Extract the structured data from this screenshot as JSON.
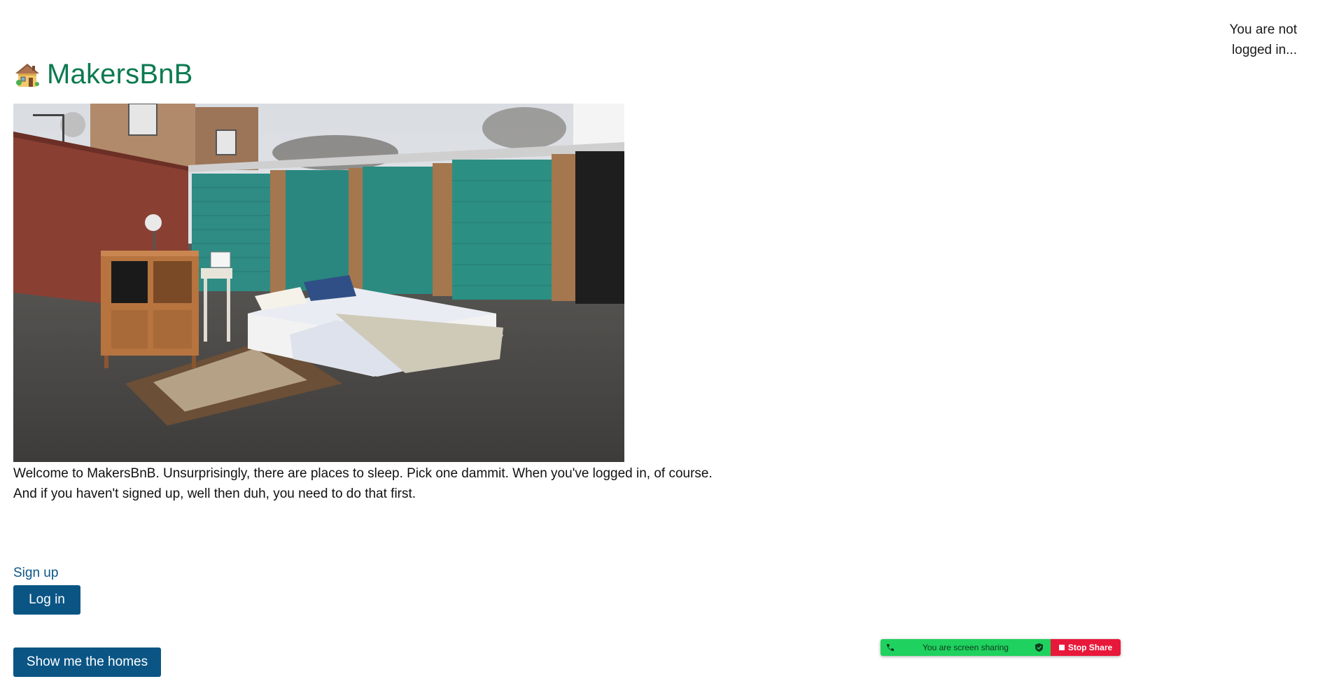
{
  "header": {
    "login_status": "You are not logged in...",
    "title": "MakersBnB",
    "logo_icon": "house-icon"
  },
  "hero": {
    "image": "bedroom-furniture-in-garage-car-park-photo"
  },
  "main": {
    "welcome_line_1": "Welcome to MakersBnB. Unsurprisingly, there are places to sleep. Pick one dammit. When you've logged in, of course.",
    "welcome_line_2": "And if you haven't signed up, well then duh, you need to do that first."
  },
  "actions": {
    "signup_label": "Sign up",
    "login_label": "Log in",
    "show_homes_label": "Show me the homes"
  },
  "screen_share": {
    "status_text": "You are screen sharing",
    "stop_label": "Stop Share"
  },
  "colors": {
    "title": "#0b7a4f",
    "button": "#0b5585",
    "link": "#0b5585",
    "share_green": "#1fd15e",
    "share_red": "#e8183a"
  }
}
